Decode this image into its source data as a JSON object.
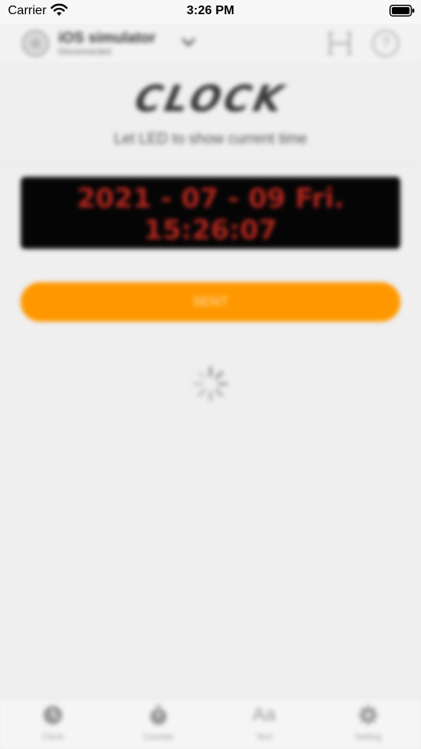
{
  "status_bar": {
    "carrier": "Carrier",
    "time": "3:26 PM"
  },
  "header": {
    "device_name": "iOS simulator",
    "device_status": "Disconnected"
  },
  "clock": {
    "logo_text": "CLOCK",
    "subtitle": "Let LED to show current time",
    "led_date": "2021 - 07 - 09 Fri.",
    "led_time": "15:26:07",
    "led_color": "#b1261f",
    "sent_label": "SENT",
    "accent_color": "#ff9800"
  },
  "tabs": [
    {
      "label": "Clock",
      "icon": "clock-icon"
    },
    {
      "label": "Counter",
      "icon": "stopwatch-icon"
    },
    {
      "label": "Text",
      "icon": "text-icon"
    },
    {
      "label": "Setting",
      "icon": "gear-icon"
    }
  ]
}
